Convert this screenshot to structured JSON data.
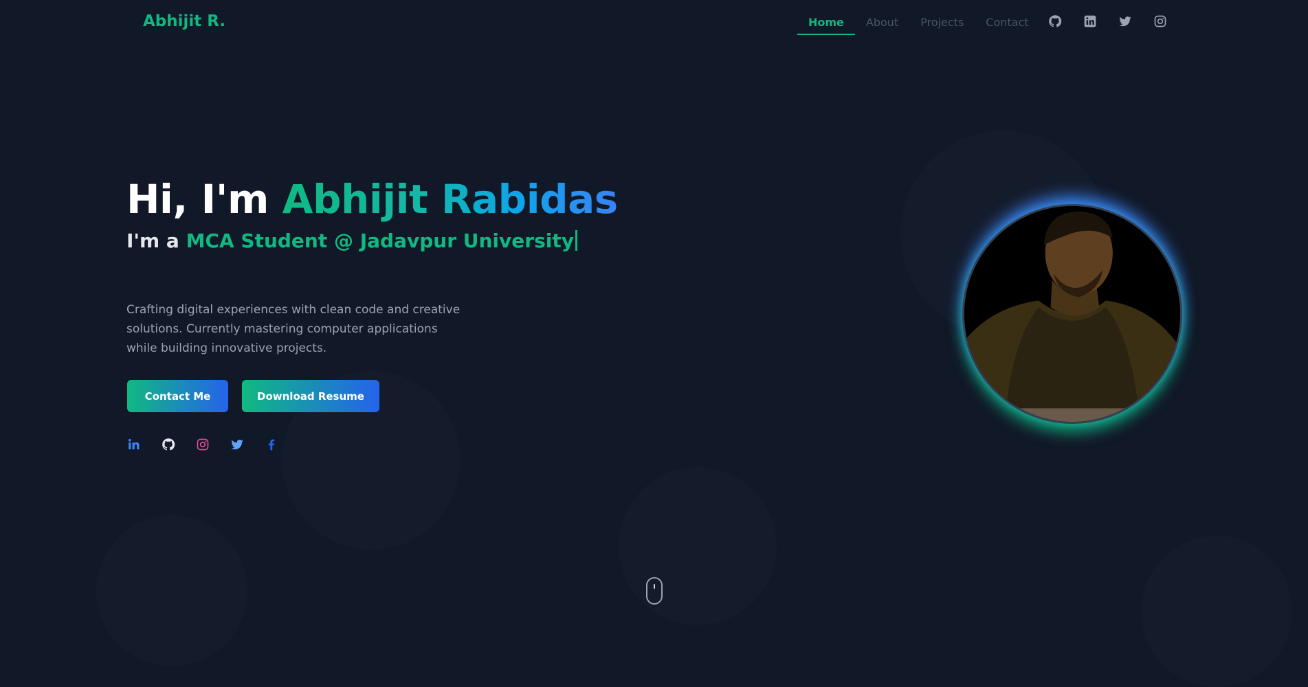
{
  "nav": {
    "logo": "Abhijit R.",
    "links": [
      {
        "label": "Home",
        "active": true
      },
      {
        "label": "About",
        "active": false
      },
      {
        "label": "Projects",
        "active": false
      },
      {
        "label": "Contact",
        "active": false
      }
    ],
    "icons": [
      "github-icon",
      "linkedin-icon",
      "twitter-icon",
      "instagram-icon"
    ]
  },
  "hero": {
    "greeting": "Hi, I'm",
    "name": "Abhijit Rabidas",
    "sub_prefix": "I'm a",
    "role": "MCA Student @ Jadavpur University",
    "description": "Crafting digital experiences with clean code and creative solutions. Currently mastering computer applications while building innovative projects.",
    "buttons": {
      "contact": "Contact Me",
      "resume": "Download Resume"
    },
    "socials": [
      "linkedin-icon",
      "github-icon",
      "instagram-icon",
      "twitter-icon",
      "facebook-icon"
    ]
  },
  "colors": {
    "background": "#111827",
    "accent_green": "#10b981",
    "accent_blue": "#3b82f6",
    "text_muted": "#9ca3af"
  }
}
